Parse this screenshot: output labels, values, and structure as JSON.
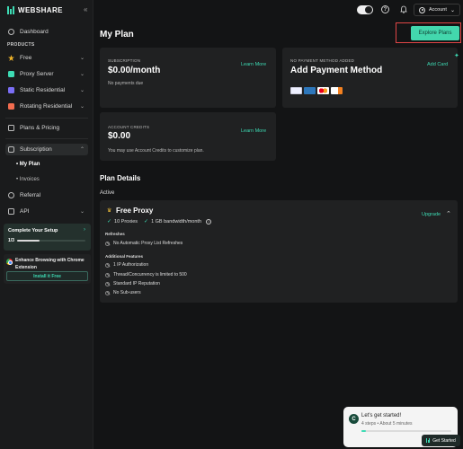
{
  "brand": {
    "name": "WEBSHARE",
    "accent": "#3ddbb4"
  },
  "sidebar": {
    "collapse_label": "«",
    "dashboard": "Dashboard",
    "products_label": "PRODUCTS",
    "products": [
      {
        "label": "Free",
        "icon": "star-icon",
        "color": "#f0b429"
      },
      {
        "label": "Proxy Server",
        "icon": "server-icon",
        "color": "#3ddbb4"
      },
      {
        "label": "Static Residential",
        "icon": "shield-icon",
        "color": "#7b6ef6"
      },
      {
        "label": "Rotating Residential",
        "icon": "rotate-icon",
        "color": "#f26c4f"
      }
    ],
    "plans_pricing": "Plans & Pricing",
    "subscription": "Subscription",
    "sub_items": [
      "My Plan",
      "Invoices"
    ],
    "referral": "Referral",
    "api": "API",
    "setup": {
      "title": "Complete Your Setup",
      "count": "1/3",
      "progress": 0.33
    },
    "chrome": {
      "text": "Enhance Browsing with Chrome Extension",
      "button": "Install it Free"
    }
  },
  "topbar": {
    "account": "Account"
  },
  "main": {
    "title": "My Plan",
    "explore_button": "Explore Plans",
    "subscription_card": {
      "label": "SUBSCRIPTION",
      "amount": "$0.00/month",
      "note": "No payments due",
      "link": "Learn More"
    },
    "payment_card": {
      "label": "NO PAYMENT METHOD ADDED",
      "title": "Add Payment Method",
      "link": "Add Card",
      "methods": [
        "VISA",
        "AMEX",
        "Mastercard",
        "Discover"
      ]
    },
    "credits_card": {
      "label": "ACCOUNT CREDITS",
      "amount": "$0.00",
      "note": "You may use Account Credits to customize plan.",
      "link": "Learn More"
    },
    "plan_details_title": "Plan Details",
    "active_label": "Active",
    "plan": {
      "name": "Free Proxy",
      "upgrade": "Upgrade",
      "proxies": "10 Proxies",
      "bandwidth": "1 GB bandwidth/month",
      "refreshes_label": "Refreshes",
      "refreshes": [
        "No Automatic Proxy List Refreshes"
      ],
      "features_label": "Additional Features",
      "features": [
        "1 IP Authorization",
        "Thread/Concurrency is limited to 500",
        "Standard IP Reputation",
        "No Sub-users"
      ]
    }
  },
  "toast": {
    "avatar": "C",
    "title": "Let's get started!",
    "subtitle": "4 steps • About 5 minutes",
    "progress": 0.05,
    "button": "Get Started"
  }
}
